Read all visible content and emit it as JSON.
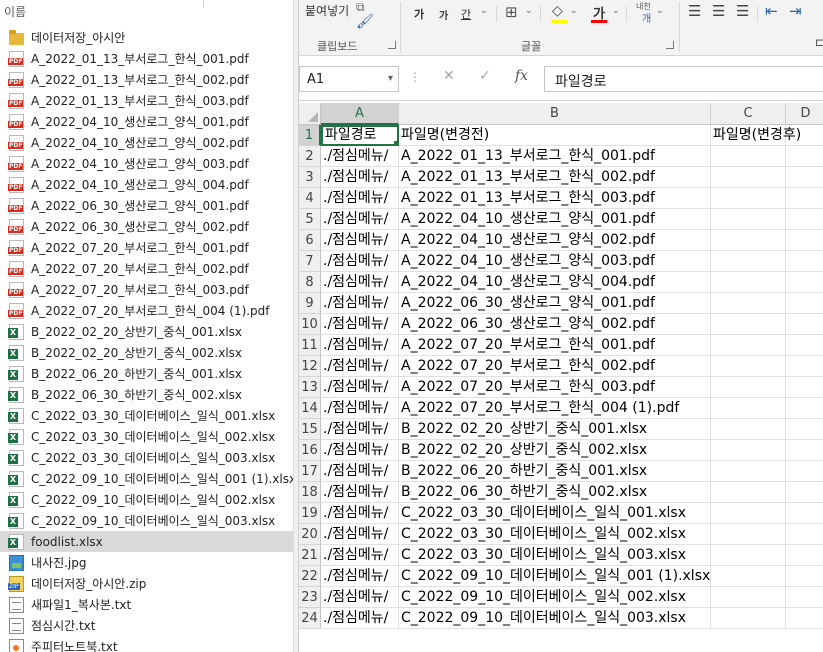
{
  "explorer": {
    "name_column": "이름",
    "files": [
      {
        "name": "데이터저장_아시안",
        "type": "folder"
      },
      {
        "name": "A_2022_01_13_부서로그_한식_001.pdf",
        "type": "pdf"
      },
      {
        "name": "A_2022_01_13_부서로그_한식_002.pdf",
        "type": "pdf"
      },
      {
        "name": "A_2022_01_13_부서로그_한식_003.pdf",
        "type": "pdf"
      },
      {
        "name": "A_2022_04_10_생산로그_양식_001.pdf",
        "type": "pdf"
      },
      {
        "name": "A_2022_04_10_생산로그_양식_002.pdf",
        "type": "pdf"
      },
      {
        "name": "A_2022_04_10_생산로그_양식_003.pdf",
        "type": "pdf"
      },
      {
        "name": "A_2022_04_10_생산로그_양식_004.pdf",
        "type": "pdf"
      },
      {
        "name": "A_2022_06_30_생산로그_양식_001.pdf",
        "type": "pdf"
      },
      {
        "name": "A_2022_06_30_생산로그_양식_002.pdf",
        "type": "pdf"
      },
      {
        "name": "A_2022_07_20_부서로그_한식_001.pdf",
        "type": "pdf"
      },
      {
        "name": "A_2022_07_20_부서로그_한식_002.pdf",
        "type": "pdf"
      },
      {
        "name": "A_2022_07_20_부서로그_한식_003.pdf",
        "type": "pdf"
      },
      {
        "name": "A_2022_07_20_부서로그_한식_004 (1).pdf",
        "type": "pdf"
      },
      {
        "name": "B_2022_02_20_상반기_중식_001.xlsx",
        "type": "xlsx"
      },
      {
        "name": "B_2022_02_20_상반기_중식_002.xlsx",
        "type": "xlsx"
      },
      {
        "name": "B_2022_06_20_하반기_중식_001.xlsx",
        "type": "xlsx"
      },
      {
        "name": "B_2022_06_30_하반기_중식_002.xlsx",
        "type": "xlsx"
      },
      {
        "name": "C_2022_03_30_데이터베이스_일식_001.xlsx",
        "type": "xlsx"
      },
      {
        "name": "C_2022_03_30_데이터베이스_일식_002.xlsx",
        "type": "xlsx"
      },
      {
        "name": "C_2022_03_30_데이터베이스_일식_003.xlsx",
        "type": "xlsx"
      },
      {
        "name": "C_2022_09_10_데이터베이스_일식_001 (1).xlsx",
        "type": "xlsx"
      },
      {
        "name": "C_2022_09_10_데이터베이스_일식_002.xlsx",
        "type": "xlsx"
      },
      {
        "name": "C_2022_09_10_데이터베이스_일식_003.xlsx",
        "type": "xlsx"
      },
      {
        "name": "foodlist.xlsx",
        "type": "xlsx",
        "selected": true
      },
      {
        "name": "내사진.jpg",
        "type": "jpg"
      },
      {
        "name": "데이터저장_아시안.zip",
        "type": "zip"
      },
      {
        "name": "새파일1_복사본.txt",
        "type": "txt"
      },
      {
        "name": "점심시간.txt",
        "type": "txt"
      },
      {
        "name": "주피터노트북.txt",
        "type": "ipynb"
      }
    ]
  },
  "ribbon": {
    "paste_label": "붙여넣기",
    "clipboard_label": "클립보드",
    "font_label": "글꼴",
    "font_grow": "가",
    "font_shrink": "가",
    "underline_btn": "간",
    "font_color_btn": "가",
    "phonetic_btn": "내천",
    "phonetic_sub": "개",
    "fill_color": "#ffff00",
    "font_color": "#ff0000"
  },
  "formula_bar": {
    "name_box": "A1",
    "formula": "파일경로",
    "dots": "⋮",
    "fx": "fx"
  },
  "sheet": {
    "columns": [
      "A",
      "B",
      "C",
      "D"
    ],
    "rows": [
      {
        "num": "1",
        "a": "파일경로",
        "b": "파일명(변경전)",
        "c": "파일명(변경후)"
      },
      {
        "num": "2",
        "a": "./점심메뉴/",
        "b": "A_2022_01_13_부서로그_한식_001.pdf",
        "c": ""
      },
      {
        "num": "3",
        "a": "./점심메뉴/",
        "b": "A_2022_01_13_부서로그_한식_002.pdf",
        "c": ""
      },
      {
        "num": "4",
        "a": "./점심메뉴/",
        "b": "A_2022_01_13_부서로그_한식_003.pdf",
        "c": ""
      },
      {
        "num": "5",
        "a": "./점심메뉴/",
        "b": "A_2022_04_10_생산로그_양식_001.pdf",
        "c": ""
      },
      {
        "num": "6",
        "a": "./점심메뉴/",
        "b": "A_2022_04_10_생산로그_양식_002.pdf",
        "c": ""
      },
      {
        "num": "7",
        "a": "./점심메뉴/",
        "b": "A_2022_04_10_생산로그_양식_003.pdf",
        "c": ""
      },
      {
        "num": "8",
        "a": "./점심메뉴/",
        "b": "A_2022_04_10_생산로그_양식_004.pdf",
        "c": ""
      },
      {
        "num": "9",
        "a": "./점심메뉴/",
        "b": "A_2022_06_30_생산로그_양식_001.pdf",
        "c": ""
      },
      {
        "num": "10",
        "a": "./점심메뉴/",
        "b": "A_2022_06_30_생산로그_양식_002.pdf",
        "c": ""
      },
      {
        "num": "11",
        "a": "./점심메뉴/",
        "b": "A_2022_07_20_부서로그_한식_001.pdf",
        "c": ""
      },
      {
        "num": "12",
        "a": "./점심메뉴/",
        "b": "A_2022_07_20_부서로그_한식_002.pdf",
        "c": ""
      },
      {
        "num": "13",
        "a": "./점심메뉴/",
        "b": "A_2022_07_20_부서로그_한식_003.pdf",
        "c": ""
      },
      {
        "num": "14",
        "a": "./점심메뉴/",
        "b": "A_2022_07_20_부서로그_한식_004 (1).pdf",
        "c": ""
      },
      {
        "num": "15",
        "a": "./점심메뉴/",
        "b": "B_2022_02_20_상반기_중식_001.xlsx",
        "c": ""
      },
      {
        "num": "16",
        "a": "./점심메뉴/",
        "b": "B_2022_02_20_상반기_중식_002.xlsx",
        "c": ""
      },
      {
        "num": "17",
        "a": "./점심메뉴/",
        "b": "B_2022_06_20_하반기_중식_001.xlsx",
        "c": ""
      },
      {
        "num": "18",
        "a": "./점심메뉴/",
        "b": "B_2022_06_30_하반기_중식_002.xlsx",
        "c": ""
      },
      {
        "num": "19",
        "a": "./점심메뉴/",
        "b": "C_2022_03_30_데이터베이스_일식_001.xlsx",
        "c": ""
      },
      {
        "num": "20",
        "a": "./점심메뉴/",
        "b": "C_2022_03_30_데이터베이스_일식_002.xlsx",
        "c": ""
      },
      {
        "num": "21",
        "a": "./점심메뉴/",
        "b": "C_2022_03_30_데이터베이스_일식_003.xlsx",
        "c": ""
      },
      {
        "num": "22",
        "a": "./점심메뉴/",
        "b": "C_2022_09_10_데이터베이스_일식_001 (1).xlsx",
        "c": ""
      },
      {
        "num": "23",
        "a": "./점심메뉴/",
        "b": "C_2022_09_10_데이터베이스_일식_002.xlsx",
        "c": ""
      },
      {
        "num": "24",
        "a": "./점심메뉴/",
        "b": "C_2022_09_10_데이터베이스_일식_003.xlsx",
        "c": ""
      }
    ]
  }
}
